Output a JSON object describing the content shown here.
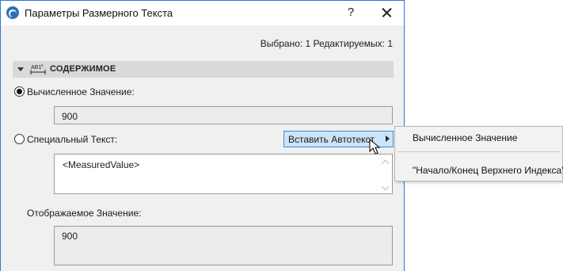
{
  "window": {
    "title": "Параметры Размерного Текста",
    "help_label": "?"
  },
  "selection_info": "Выбрано: 1 Редактируемых: 1",
  "section": {
    "title": "СОДЕРЖИМОЕ",
    "icon": "dimension-text-icon",
    "icon_text": "AB1"
  },
  "options": {
    "computed_label": "Вычисленное Значение:",
    "computed_value": "900",
    "computed_selected": true,
    "custom_label": "Специальный Текст:",
    "custom_selected": false,
    "custom_text": "<MeasuredValue>"
  },
  "insert_button": {
    "label": "Вставить Автотекст"
  },
  "autotext_menu": {
    "items": [
      {
        "label": "Вычисленное Значение"
      },
      {
        "label": "\"Начало/Конец Верхнего Индекса\""
      }
    ]
  },
  "display": {
    "label": "Отображаемое Значение:",
    "value": "900"
  },
  "colors": {
    "accent": "#2b79d0",
    "button_highlight": "#cce4f7",
    "section_bg": "#d9d9d9",
    "dialog_bg": "#f0f0f0"
  }
}
